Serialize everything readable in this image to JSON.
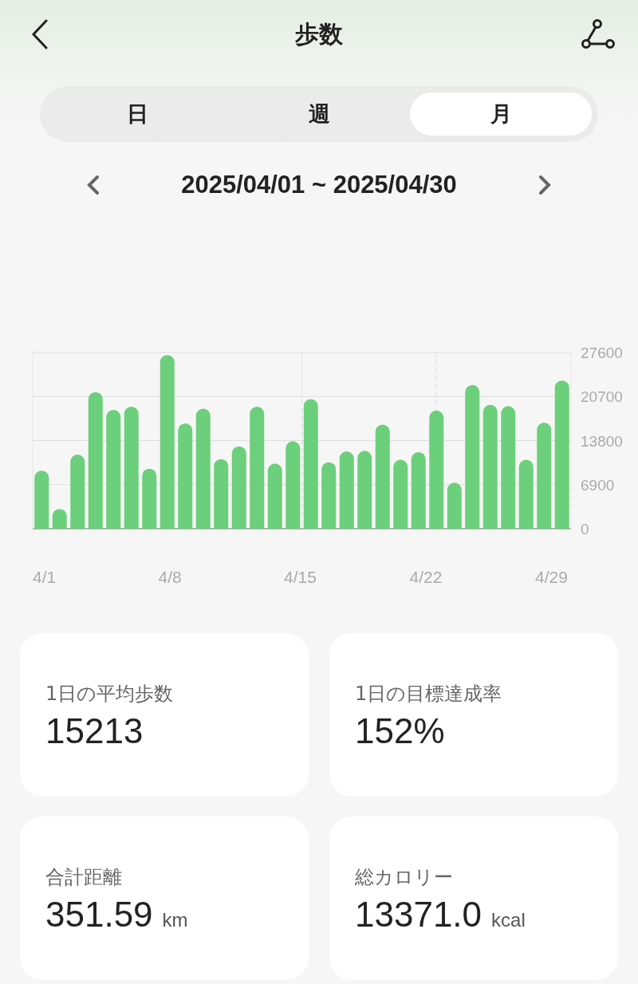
{
  "header": {
    "title": "歩数"
  },
  "tabs": [
    {
      "label": "日",
      "selected": false
    },
    {
      "label": "週",
      "selected": false
    },
    {
      "label": "月",
      "selected": true
    }
  ],
  "date_range": {
    "label": "2025/04/01 ~ 2025/04/30"
  },
  "chart": {
    "chart_data": {
      "type": "bar",
      "grid": true,
      "categories": [
        "4/1",
        null,
        null,
        null,
        null,
        null,
        null,
        "4/8",
        null,
        null,
        null,
        null,
        null,
        null,
        "4/15",
        null,
        null,
        null,
        null,
        null,
        null,
        "4/22",
        null,
        null,
        null,
        null,
        null,
        null,
        "4/29",
        null
      ],
      "values": [
        9100,
        3100,
        11600,
        21400,
        18600,
        19100,
        9400,
        27200,
        16500,
        18800,
        10900,
        12900,
        19100,
        10200,
        13700,
        20300,
        10400,
        12100,
        12200,
        16300,
        10800,
        12000,
        18500,
        7200,
        22500,
        19400,
        19200,
        10800,
        16600,
        23200
      ],
      "ylim": [
        0,
        27600
      ],
      "yticks": [
        0,
        6900,
        13800,
        20700,
        27600
      ]
    }
  },
  "stats": [
    {
      "label": "1日の平均歩数",
      "value": "15213"
    },
    {
      "label": "1日の目標達成率",
      "value": "152%"
    },
    {
      "label": "合計距離",
      "value": "351.59",
      "unit": "km"
    },
    {
      "label": "総カロリー",
      "value": "13371.0",
      "unit": "kcal"
    }
  ]
}
